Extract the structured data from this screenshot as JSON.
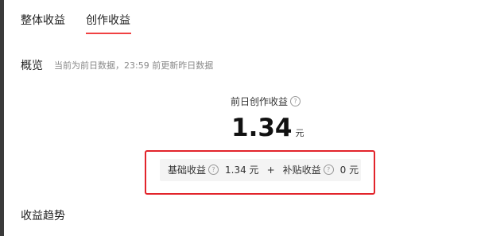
{
  "tabs": [
    {
      "label": "整体收益",
      "active": false
    },
    {
      "label": "创作收益",
      "active": true
    }
  ],
  "accent_color": "#f04142",
  "overview": {
    "title": "概览",
    "note": "当前为前日数据，23:59 前更新昨日数据"
  },
  "metric": {
    "label": "前日创作收益",
    "value": "1.34",
    "unit": "元"
  },
  "breakdown": {
    "base_label": "基础收益",
    "base_value": "1.34 元",
    "plus": "+",
    "subsidy_label": "补贴收益",
    "subsidy_value": "0 元"
  },
  "trend": {
    "title": "收益趋势"
  },
  "icons": {
    "help": "?"
  },
  "highlight_color": "#e2242b"
}
